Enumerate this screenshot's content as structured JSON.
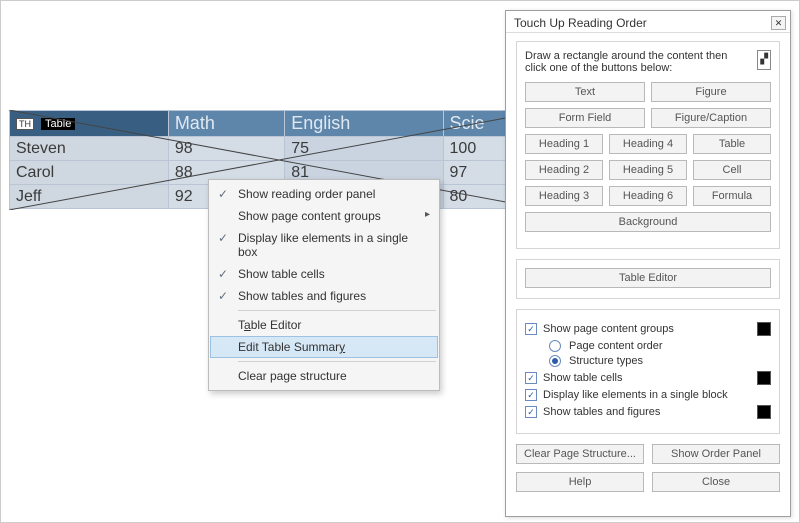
{
  "table": {
    "tag": "TH",
    "label": "Table",
    "headers": [
      "",
      "Math",
      "English",
      "Scie"
    ],
    "rows": [
      {
        "name": "Steven",
        "cells": [
          "98",
          "75",
          "100"
        ]
      },
      {
        "name": "Carol",
        "cells": [
          "88",
          "81",
          "97"
        ]
      },
      {
        "name": "Jeff",
        "cells": [
          "92",
          "",
          "80"
        ]
      }
    ]
  },
  "context_menu": {
    "items": [
      {
        "label": "Show reading order panel",
        "checked": true
      },
      {
        "label": "Show page content groups",
        "submenu": true
      },
      {
        "label": "Display like elements in a single box",
        "checked": true
      },
      {
        "label": "Show table cells",
        "checked": true
      },
      {
        "label": "Show tables and figures",
        "checked": true
      }
    ],
    "items2": [
      {
        "label": "Table Editor"
      },
      {
        "label": "Edit Table Summary",
        "hover": true
      }
    ],
    "items3": [
      {
        "label": "Clear page structure"
      }
    ]
  },
  "dialog": {
    "title": "Touch Up Reading Order",
    "instruction": "Draw a rectangle around the content then click one of the buttons below:",
    "buttons": {
      "text": "Text",
      "figure": "Figure",
      "formfield": "Form Field",
      "figcaption": "Figure/Caption",
      "h1": "Heading 1",
      "h4": "Heading 4",
      "table": "Table",
      "h2": "Heading 2",
      "h5": "Heading 5",
      "cell": "Cell",
      "h3": "Heading 3",
      "h6": "Heading 6",
      "formula": "Formula",
      "background": "Background",
      "table_editor": "Table Editor"
    },
    "options": {
      "show_groups": "Show page content groups",
      "page_content_order": "Page content order",
      "structure_types": "Structure types",
      "show_cells": "Show table cells",
      "display_like": "Display like elements in a single block",
      "show_tables_figures": "Show tables and figures"
    },
    "bottom": {
      "clear": "Clear Page Structure...",
      "order": "Show Order Panel",
      "help": "Help",
      "close": "Close"
    }
  }
}
